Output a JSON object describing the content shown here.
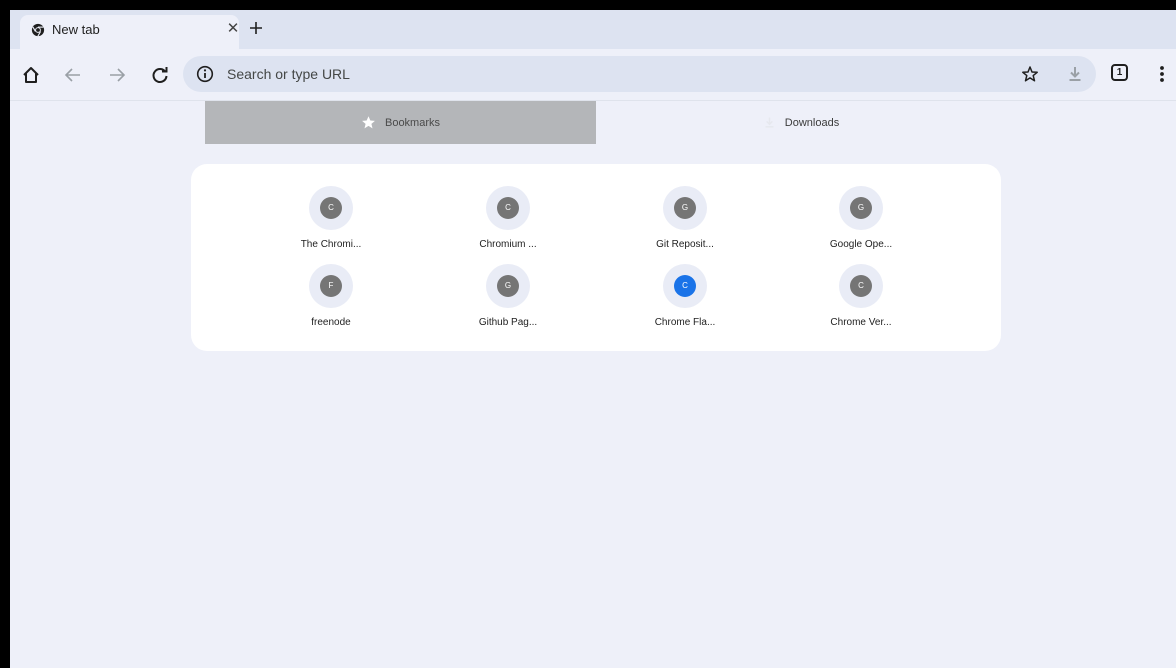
{
  "tab": {
    "title": "New tab",
    "close_icon": "close-icon",
    "new_tab_icon": "plus-icon"
  },
  "toolbar": {
    "omnibox_placeholder": "Search or type URL",
    "tab_count": "1"
  },
  "content_tabs": [
    {
      "label": "Bookmarks",
      "icon": "star-icon",
      "selected": true
    },
    {
      "label": "Downloads",
      "icon": "download-icon",
      "selected": false
    }
  ],
  "shortcuts": [
    {
      "letter": "C",
      "label": "The Chromi...",
      "color": "#757575"
    },
    {
      "letter": "C",
      "label": "Chromium ...",
      "color": "#757575"
    },
    {
      "letter": "G",
      "label": "Git Reposit...",
      "color": "#757575"
    },
    {
      "letter": "G",
      "label": "Google Ope...",
      "color": "#757575"
    },
    {
      "letter": "F",
      "label": "freenode",
      "color": "#757575"
    },
    {
      "letter": "G",
      "label": "Github Pag...",
      "color": "#757575"
    },
    {
      "letter": "C",
      "label": "Chrome Fla...",
      "color": "#1a73e8"
    },
    {
      "letter": "C",
      "label": "Chrome Ver...",
      "color": "#757575"
    }
  ],
  "colors": {
    "background": "#eef0f9",
    "tabstrip": "#dde3f1",
    "selected_tab": "#b4b6b9",
    "accent_blue": "#1a73e8"
  }
}
